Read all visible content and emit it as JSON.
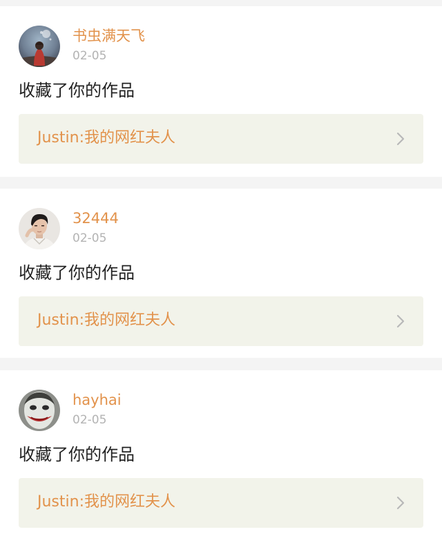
{
  "notifications": [
    {
      "username": "书虫满天飞",
      "date": "02-05",
      "action_text": "收藏了你的作品",
      "work_title": "Justin:我的网红夫人",
      "avatar_icon": "avatar-girl-icon"
    },
    {
      "username": "32444",
      "date": "02-05",
      "action_text": "收藏了你的作品",
      "work_title": "Justin:我的网红夫人",
      "avatar_icon": "avatar-man-icon"
    },
    {
      "username": "hayhai",
      "date": "02-05",
      "action_text": "收藏了你的作品",
      "work_title": "Justin:我的网红夫人",
      "avatar_icon": "avatar-joker-icon"
    }
  ],
  "colors": {
    "accent": "#e2924b",
    "date": "#b3b3b3",
    "link_bg": "#f2f3ea",
    "page_bg": "#f4f4f4"
  }
}
